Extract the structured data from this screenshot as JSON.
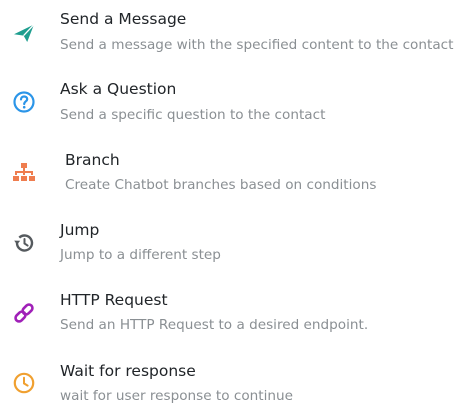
{
  "items": [
    {
      "title": "Send a Message",
      "description": "Send a message with the specified content to the contact",
      "icon": "send-icon",
      "color": "#1e9e8f"
    },
    {
      "title": "Ask a Question",
      "description": "Send a specific question to the contact",
      "icon": "question-icon",
      "color": "#2b95e8"
    },
    {
      "title": "Branch",
      "description": "Create Chatbot branches based on conditions",
      "icon": "branch-icon",
      "color": "#ef7d4f"
    },
    {
      "title": "Jump",
      "description": "Jump to a different step",
      "icon": "history-icon",
      "color": "#555a5e"
    },
    {
      "title": "HTTP Request",
      "description": "Send an HTTP Request to a desired endpoint.",
      "icon": "link-icon",
      "color": "#a020b8"
    },
    {
      "title": "Wait for response",
      "description": "wait for user response to continue",
      "icon": "clock-icon",
      "color": "#f0a030"
    }
  ]
}
